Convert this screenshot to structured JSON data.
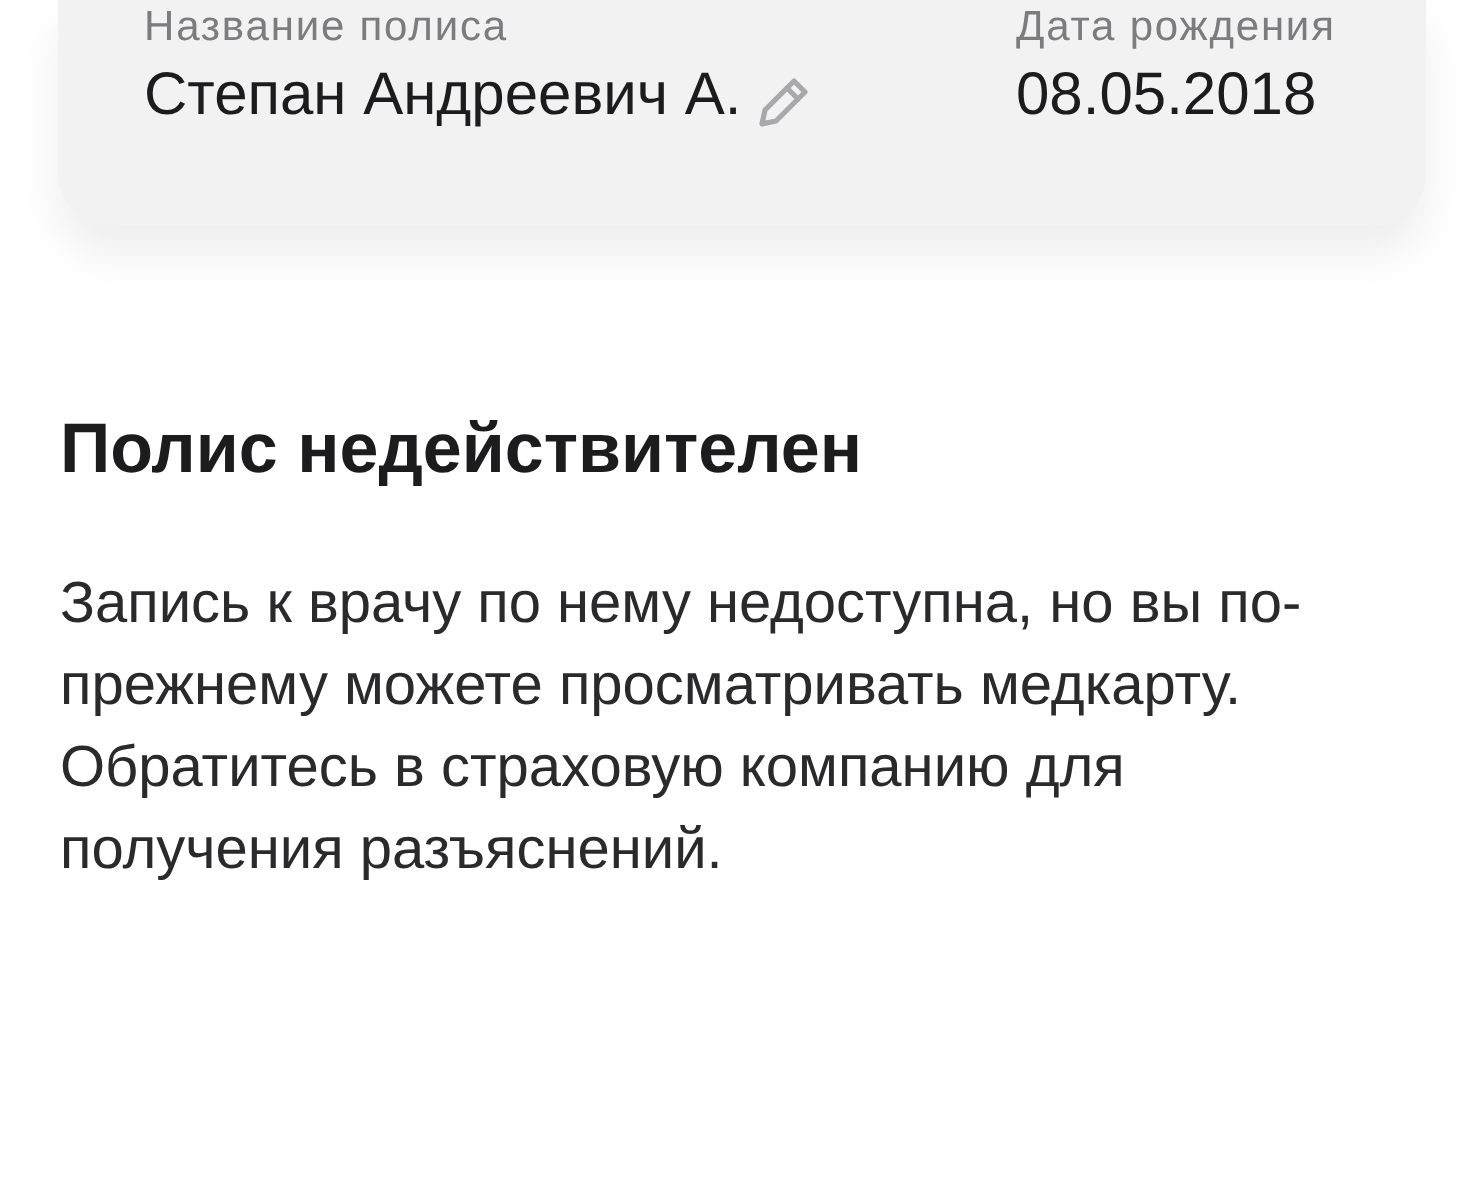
{
  "card": {
    "fields": [
      {
        "label": "Название полиса",
        "value": "Степан Андреевич А.",
        "editable": true
      },
      {
        "label": "Дата рождения",
        "value": "08.05.2018",
        "editable": false
      }
    ]
  },
  "notice": {
    "title": "Полис недействителен",
    "text": "Запись к врачу по нему недоступна, но вы по-прежнему можете просматривать медкарту. Обратитесь в страховую компанию для получения разъяснений."
  }
}
